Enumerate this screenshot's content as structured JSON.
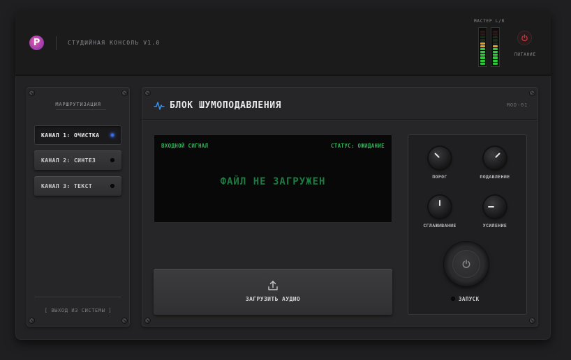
{
  "header": {
    "logo_letter": "P",
    "app_title": "СТУДИЙНАЯ КОНСОЛЬ V1.0",
    "master_label": "МАСТЕР L/R",
    "power_label": "ПИТАНИЕ",
    "meters": {
      "left_level": 0.65,
      "right_level": 0.62
    },
    "colors": {
      "power": "#c93a3a",
      "meter_green": "#2ecc3a",
      "meter_yellow": "#e0a72a"
    }
  },
  "sidebar": {
    "title": "МАРШРУТИЗАЦИЯ",
    "channels": [
      {
        "label": "КАНАЛ 1: ОЧИСТКА",
        "active": true
      },
      {
        "label": "КАНАЛ 2: СИНТЕЗ",
        "active": false
      },
      {
        "label": "КАНАЛ 3: ТЕКСТ",
        "active": false
      }
    ],
    "logout": "[ ВЫХОД ИЗ СИСТЕМЫ ]"
  },
  "main": {
    "icon": "waveform-icon",
    "title": "БЛОК ШУМОПОДАВЛЕНИЯ",
    "module_id": "MOD-01",
    "screen": {
      "input_label": "ВХОДНОЙ СИГНАЛ",
      "status": "СТАТУС: ОЖИДАНИЕ",
      "message": "ФАЙЛ НЕ ЗАГРУЖЕН"
    },
    "upload_label": "ЗАГРУЗИТЬ АУДИО",
    "knobs": [
      {
        "label": "ПОРОГ",
        "angle_deg": -45
      },
      {
        "label": "ПОДАВЛЕНИЕ",
        "angle_deg": 45
      },
      {
        "label": "СГЛАЖИВАНИЕ",
        "angle_deg": 0
      },
      {
        "label": "УСИЛЕНИЕ",
        "angle_deg": -90
      }
    ],
    "start_label": "ЗАПУСК",
    "accent_color": "#3b8fe6",
    "screen_color": "#2fb356"
  }
}
